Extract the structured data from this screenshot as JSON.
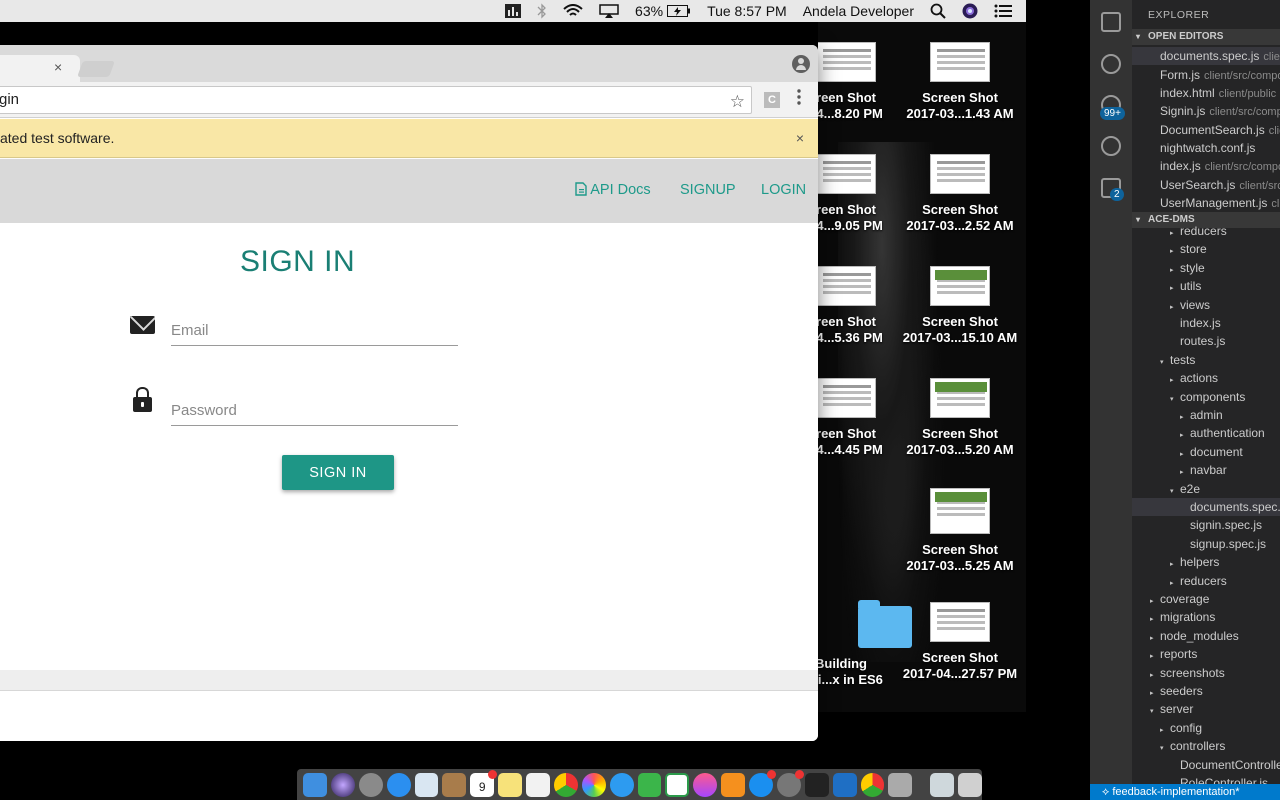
{
  "menubar": {
    "battery": "63%",
    "clock": "Tue 8:57 PM",
    "user": "Andela Developer"
  },
  "desktop": {
    "icons": [
      {
        "line1": "reen Shot",
        "line2": "04...8.20 PM"
      },
      {
        "line1": "Screen Shot",
        "line2": "2017-03...1.43 AM"
      },
      {
        "line1": "reen Shot",
        "line2": "04...9.05 PM"
      },
      {
        "line1": "Screen Shot",
        "line2": "2017-03...2.52 AM"
      },
      {
        "line1": "reen Shot",
        "line2": "04...5.36 PM"
      },
      {
        "line1": "Screen Shot",
        "line2": "2017-03...15.10 AM"
      },
      {
        "line1": "reen Shot",
        "line2": "04...4.45 PM"
      },
      {
        "line1": "Screen Shot",
        "line2": "2017-03...5.20 AM"
      },
      {
        "line1": "Screen Shot",
        "line2": "2017-03...5.25 AM"
      },
      {
        "line1": "Building",
        "line2": "cati...x in ES6"
      },
      {
        "line1": "Screen Shot",
        "line2": "2017-04...27.57 PM"
      }
    ]
  },
  "browser": {
    "tab_close": "×",
    "url": "gin",
    "extension_label": "C",
    "infobar_text": "ated test software.",
    "infobar_close": "×"
  },
  "app": {
    "nav": {
      "api_docs": "API Docs",
      "signup": "SIGNUP",
      "login": "LOGIN"
    },
    "title": "SIGN IN",
    "email_placeholder": "Email",
    "password_placeholder": "Password",
    "submit_label": "SIGN IN"
  },
  "dock": {
    "calendar_day": "9"
  },
  "vscode": {
    "explorer_title": "EXPLORER",
    "activity_badge_scm": "99+",
    "activity_badge_ext": "2",
    "open_editors_header": "OPEN EDITORS",
    "open_editors": [
      {
        "name": "documents.spec.js",
        "path": "clien"
      },
      {
        "name": "Form.js",
        "path": "client/src/compo"
      },
      {
        "name": "index.html",
        "path": "client/public"
      },
      {
        "name": "Signin.js",
        "path": "client/src/comp"
      },
      {
        "name": "DocumentSearch.js",
        "path": "clie"
      },
      {
        "name": "nightwatch.conf.js",
        "path": ""
      },
      {
        "name": "index.js",
        "path": "client/src/compo"
      },
      {
        "name": "UserSearch.js",
        "path": "client/src/"
      },
      {
        "name": "UserManagement.js",
        "path": "clie"
      }
    ],
    "project_header": "ACE-DMS",
    "tree": [
      {
        "label": "reducers",
        "indent": 1,
        "caret": "▸"
      },
      {
        "label": "store",
        "indent": 1,
        "caret": "▸"
      },
      {
        "label": "style",
        "indent": 1,
        "caret": "▸"
      },
      {
        "label": "utils",
        "indent": 1,
        "caret": "▸"
      },
      {
        "label": "views",
        "indent": 1,
        "caret": "▸"
      },
      {
        "label": "index.js",
        "indent": 1,
        "caret": ""
      },
      {
        "label": "routes.js",
        "indent": 1,
        "caret": ""
      },
      {
        "label": "tests",
        "indent": 0,
        "caret": "▾"
      },
      {
        "label": "actions",
        "indent": 1,
        "caret": "▸"
      },
      {
        "label": "components",
        "indent": 1,
        "caret": "▾"
      },
      {
        "label": "admin",
        "indent": 2,
        "caret": "▸"
      },
      {
        "label": "authentication",
        "indent": 2,
        "caret": "▸"
      },
      {
        "label": "document",
        "indent": 2,
        "caret": "▸"
      },
      {
        "label": "navbar",
        "indent": 2,
        "caret": "▸"
      },
      {
        "label": "e2e",
        "indent": 1,
        "caret": "▾"
      },
      {
        "label": "documents.spec.js",
        "indent": 2,
        "caret": ""
      },
      {
        "label": "signin.spec.js",
        "indent": 2,
        "caret": ""
      },
      {
        "label": "signup.spec.js",
        "indent": 2,
        "caret": ""
      },
      {
        "label": "helpers",
        "indent": 1,
        "caret": "▸"
      },
      {
        "label": "reducers",
        "indent": 1,
        "caret": "▸"
      },
      {
        "label": "coverage",
        "indent": -1,
        "caret": "▸"
      },
      {
        "label": "migrations",
        "indent": -1,
        "caret": "▸"
      },
      {
        "label": "node_modules",
        "indent": -1,
        "caret": "▸"
      },
      {
        "label": "reports",
        "indent": -1,
        "caret": "▸"
      },
      {
        "label": "screenshots",
        "indent": -1,
        "caret": "▸"
      },
      {
        "label": "seeders",
        "indent": -1,
        "caret": "▸"
      },
      {
        "label": "server",
        "indent": -1,
        "caret": "▾"
      },
      {
        "label": "config",
        "indent": 0,
        "caret": "▸"
      },
      {
        "label": "controllers",
        "indent": 0,
        "caret": "▾"
      },
      {
        "label": "DocumentControlle",
        "indent": 1,
        "caret": ""
      },
      {
        "label": "RoleController.js",
        "indent": 1,
        "caret": ""
      }
    ],
    "status_branch": "feedback-implementation*"
  },
  "colors": {
    "accent": "#1e9686",
    "title": "#1a7f74",
    "infobar": "#f9e7a6",
    "vscode_status": "#007acc"
  }
}
